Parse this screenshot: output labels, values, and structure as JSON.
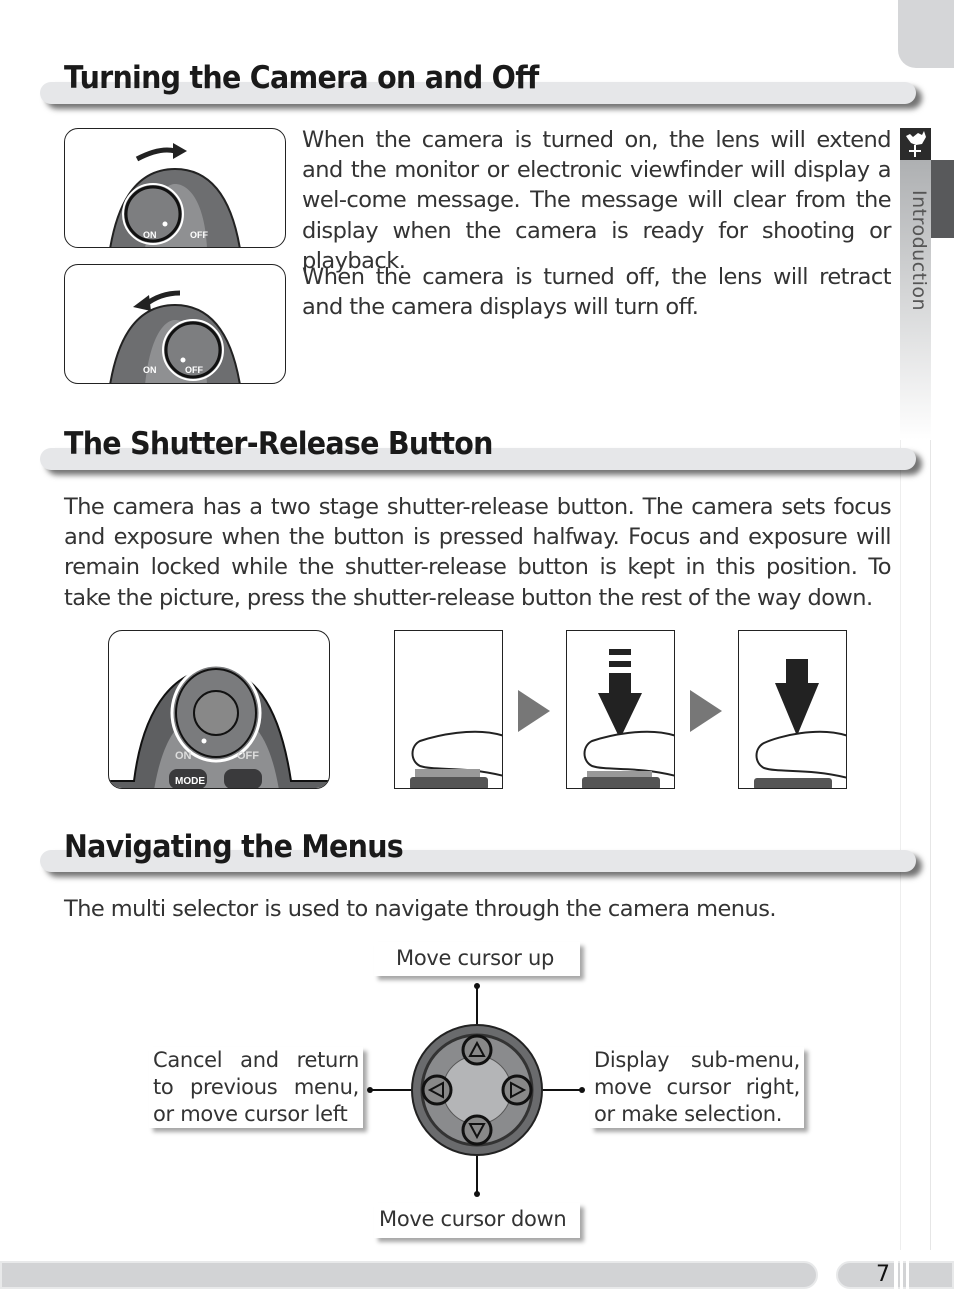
{
  "sections": [
    {
      "title": "Turning the Camera on and Off",
      "paragraphs": [
        "When the camera is turned on, the lens will extend and the monitor or electronic viewfinder will display a wel-come message.  The message will clear from the display when the camera is ready for shooting or playback.",
        "When the camera is turned off, the lens will retract and the camera displays will turn off."
      ]
    },
    {
      "title": "The Shutter-Release Button",
      "paragraphs": [
        "The camera has a two stage shutter-release button.  The camera sets focus and exposure when the button is pressed halfway.  Focus and exposure will remain locked while the shutter-release button is kept in this position.  To take the picture, press the shutter-release button the rest of the way down."
      ]
    },
    {
      "title": "Navigating the Menus",
      "paragraphs": [
        "The multi selector is used to navigate through the camera menus."
      ]
    }
  ],
  "illustration_labels": {
    "on": "ON",
    "off": "OFF",
    "mode": "MODE"
  },
  "multi_selector": {
    "up": "Move cursor up",
    "down": "Move cursor down",
    "left": "Cancel and return to previous menu, or move cursor left",
    "right": "Display sub-menu, move cursor right, or make selection."
  },
  "sidebar": {
    "tab_label": "Introduction",
    "icon": "weathervane-rooster-icon"
  },
  "footer": {
    "page_number": "7"
  }
}
